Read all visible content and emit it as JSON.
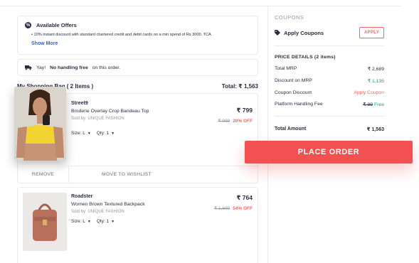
{
  "offers": {
    "title": "Available Offers",
    "line": "10% instant discount with standard chartered credit and debit cards on a min spend of Rs 3000. TCA",
    "show_more": "Show More"
  },
  "handling": {
    "prefix": "Yay!",
    "bold": "No handling free",
    "suffix": "on this order."
  },
  "bag": {
    "title": "My Shopping Bag ( 2 Items )",
    "total": "Total: ₹ 1,563"
  },
  "items": [
    {
      "brand": "Street9",
      "name": "Broderie Overlay Crop Bandeau Top",
      "seller": "Sold by: UNIQUE FASHION",
      "size": "Size: L",
      "qty": "Qty: 1",
      "price": "₹ 799",
      "mrp": "₹ 999",
      "discount": "20% OFF",
      "remove": "REMOVE",
      "wishlist": "MOVE TO WISHLIST"
    },
    {
      "brand": "Roadster",
      "name": "Women Brown Textured Backpack",
      "seller": "Sold by: UNIQUE FASHION",
      "size": "Size: L",
      "qty": "Qty: 1",
      "price": "₹ 764",
      "mrp": "₹ 1,699",
      "discount": "54% OFF"
    }
  ],
  "coupons": {
    "title": "COUPONS",
    "apply_label": "Apply Coupons",
    "apply_button": "APPLY"
  },
  "price_details": {
    "title": "PRICE DETAILS (2 items)",
    "rows": [
      {
        "label": "Total MRP",
        "value": "₹ 2,689"
      },
      {
        "label": "Discount on MRP",
        "value": "₹ 1,135"
      },
      {
        "label": "Coupon Discount",
        "value": "Apply Coupon"
      },
      {
        "label": "Platform Handling Fee",
        "strike": "₹ 99",
        "value": "Free"
      }
    ],
    "total_label": "Total Amount",
    "total_value": "₹ 1,563"
  },
  "place_order": "PLACE ORDER",
  "colors": {
    "accent": "#f35151",
    "green": "#03a685",
    "link": "#3066c4"
  }
}
